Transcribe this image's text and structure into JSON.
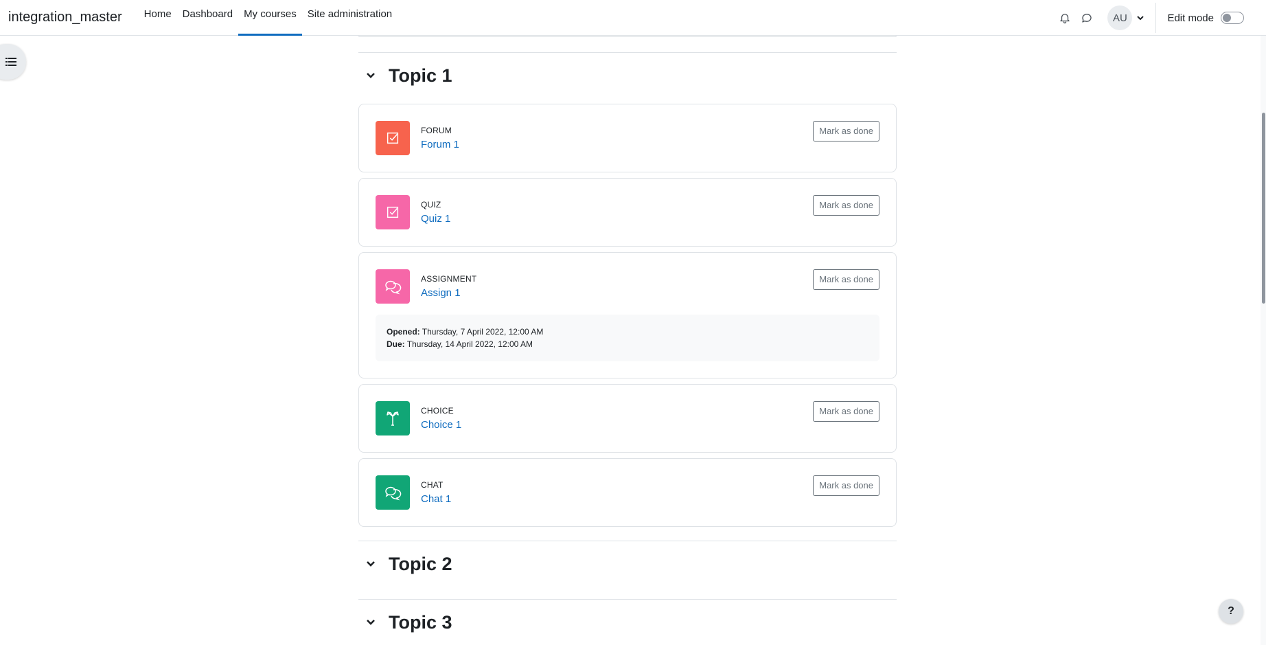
{
  "navbar": {
    "brand": "integration_master",
    "links": [
      {
        "label": "Home",
        "active": false
      },
      {
        "label": "Dashboard",
        "active": false
      },
      {
        "label": "My courses",
        "active": true
      },
      {
        "label": "Site administration",
        "active": false
      }
    ],
    "avatar_initials": "AU",
    "edit_mode_label": "Edit mode",
    "edit_mode_on": false
  },
  "icons": {
    "notifications": "bell-icon",
    "messages": "chat-bubble-icon",
    "user_menu": "chevron-down-icon",
    "drawer": "list-icon",
    "help": "question-icon"
  },
  "help_label": "?",
  "colors": {
    "link": "#0f6cbf",
    "forum": "#f7634d",
    "quiz": "#f667a8",
    "assignment": "#f667a8",
    "choice": "#11a676",
    "chat": "#11a676"
  },
  "sections": [
    {
      "title": "Topic 1",
      "activities": [
        {
          "type": "FORUM",
          "name": "Forum 1",
          "button": "Mark as done",
          "icon": "checkbox-icon",
          "color": "#f7634d"
        },
        {
          "type": "QUIZ",
          "name": "Quiz 1",
          "button": "Mark as done",
          "icon": "checkbox-icon",
          "color": "#f667a8"
        },
        {
          "type": "ASSIGNMENT",
          "name": "Assign 1",
          "button": "Mark as done",
          "icon": "speech-bubbles-icon",
          "color": "#f667a8",
          "dates": {
            "opened_label": "Opened:",
            "opened_value": " Thursday, 7 April 2022, 12:00 AM",
            "due_label": "Due:",
            "due_value": " Thursday, 14 April 2022, 12:00 AM"
          }
        },
        {
          "type": "CHOICE",
          "name": "Choice 1",
          "button": "Mark as done",
          "icon": "signpost-icon",
          "color": "#11a676"
        },
        {
          "type": "CHAT",
          "name": "Chat 1",
          "button": "Mark as done",
          "icon": "speech-bubbles-icon",
          "color": "#11a676"
        }
      ]
    },
    {
      "title": "Topic 2",
      "activities": []
    },
    {
      "title": "Topic 3",
      "activities": []
    }
  ]
}
